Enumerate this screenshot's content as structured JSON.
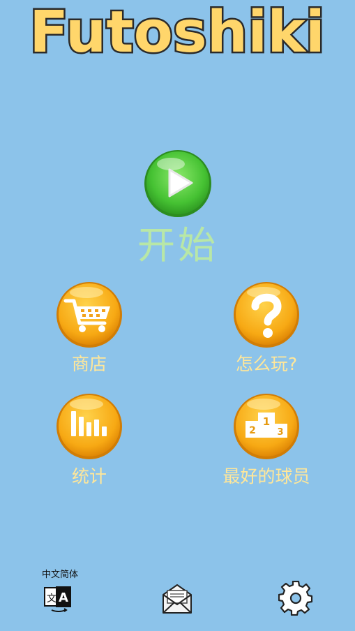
{
  "app_title": "Futoshiki",
  "start": {
    "label": "开始"
  },
  "menu": {
    "shop_label": "商店",
    "howto_label": "怎么玩?",
    "stats_label": "统计",
    "leaderboard_label": "最好的球员"
  },
  "bottom": {
    "language_label": "中文简体"
  },
  "colors": {
    "background": "#8cc3ea",
    "title_fill": "#ffd66b",
    "coin_orange": "#f6a412",
    "play_green": "#4cc93a",
    "start_text": "#b8e7a7",
    "menu_text": "#ffe79a"
  },
  "icons": {
    "play": "play-icon",
    "shop": "shopping-cart-icon",
    "howto": "question-mark-icon",
    "stats": "bar-chart-icon",
    "leaderboard": "podium-icon",
    "language": "translate-icon",
    "mail": "envelope-icon",
    "settings": "gear-icon"
  }
}
